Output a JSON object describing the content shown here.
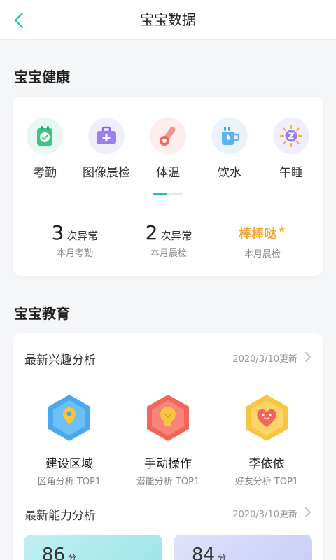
{
  "header": {
    "title": "宝宝数据"
  },
  "health": {
    "section_title": "宝宝健康",
    "features": [
      {
        "label": "考勤",
        "icon": "attendance-icon"
      },
      {
        "label": "图像晨检",
        "icon": "medical-kit-icon"
      },
      {
        "label": "体温",
        "icon": "thermometer-icon"
      },
      {
        "label": "饮水",
        "icon": "water-cup-icon"
      },
      {
        "label": "午睡",
        "icon": "nap-icon"
      }
    ],
    "page_indicator_progress": 0.45,
    "stats": [
      {
        "value": "3",
        "unit": "次异常",
        "caption": "本月考勤"
      },
      {
        "value": "2",
        "unit": "次异常",
        "caption": "本月晨检"
      },
      {
        "value": "棒棒哒",
        "caption": "本月晨检"
      }
    ]
  },
  "education": {
    "section_title": "宝宝教育",
    "interest": {
      "title": "最新兴趣分析",
      "updated": "2020/3/10更新",
      "items": [
        {
          "name": "建设区域",
          "tag": "区角分析 TOP1",
          "icon": "location-pin-icon"
        },
        {
          "name": "手动操作",
          "tag": "潜能分析 TOP1",
          "icon": "lightbulb-icon"
        },
        {
          "name": "李依依",
          "tag": "好友分析 TOP1",
          "icon": "heart-icon"
        }
      ]
    },
    "ability": {
      "title": "最新能力分析",
      "updated": "2020/3/10更新",
      "scores": [
        {
          "value": "86",
          "unit": "分"
        },
        {
          "value": "84",
          "unit": "分"
        }
      ]
    }
  },
  "colors": {
    "accent": "#1fc3b8",
    "praise": "#f5a43a",
    "background": "#f5f6f8"
  }
}
